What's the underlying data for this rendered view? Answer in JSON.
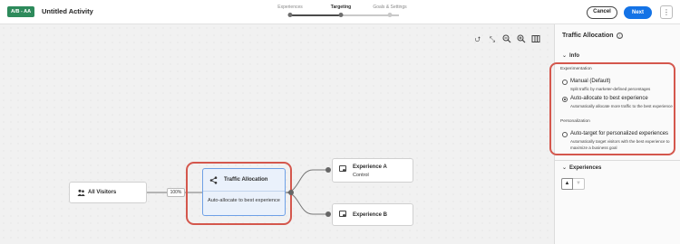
{
  "header": {
    "badge": "A/B - AA",
    "title": "Untitled Activity",
    "steps": [
      "Experiences",
      "Targeting",
      "Goals & Settings"
    ],
    "active_step": 1,
    "cancel_label": "Cancel",
    "next_label": "Next",
    "more_label": "⋮"
  },
  "toolbar": {
    "icons": [
      "reroute-icon",
      "collapse-icon",
      "zoom-out-icon",
      "zoom-in-icon",
      "columns-icon"
    ]
  },
  "canvas": {
    "all_visitors_label": "All Visitors",
    "percent_label": "100%",
    "traffic_node": {
      "title": "Traffic Allocation",
      "description": "Auto-allocate to best experience"
    },
    "experience_a": {
      "title": "Experience A",
      "subtitle": "Control"
    },
    "experience_b": {
      "title": "Experience B"
    }
  },
  "panel": {
    "title": "Traffic Allocation",
    "info_icon": "ⓘ",
    "info_section": "Info",
    "experimentation_label": "Experimentation",
    "personalization_label": "Personalization",
    "options": [
      {
        "label": "Manual (Default)",
        "desc": "Split traffic by marketer-defined percentages",
        "selected": false
      },
      {
        "label": "Auto-allocate to best experience",
        "desc": "Automatically allocate more traffic to the best experience",
        "selected": true
      },
      {
        "label": "Auto-target for personalized experiences",
        "desc": "Automatically target visitors with the best experience to maximize a business goal",
        "selected": false
      }
    ],
    "experiences_section": "Experiences",
    "move_up": "▲",
    "move_down": "▼"
  },
  "colors": {
    "accent_blue": "#1473e6",
    "badge_green": "#2d8a5b",
    "highlight_red": "#d4574d",
    "node_selected_bg": "#eaf1fb"
  }
}
